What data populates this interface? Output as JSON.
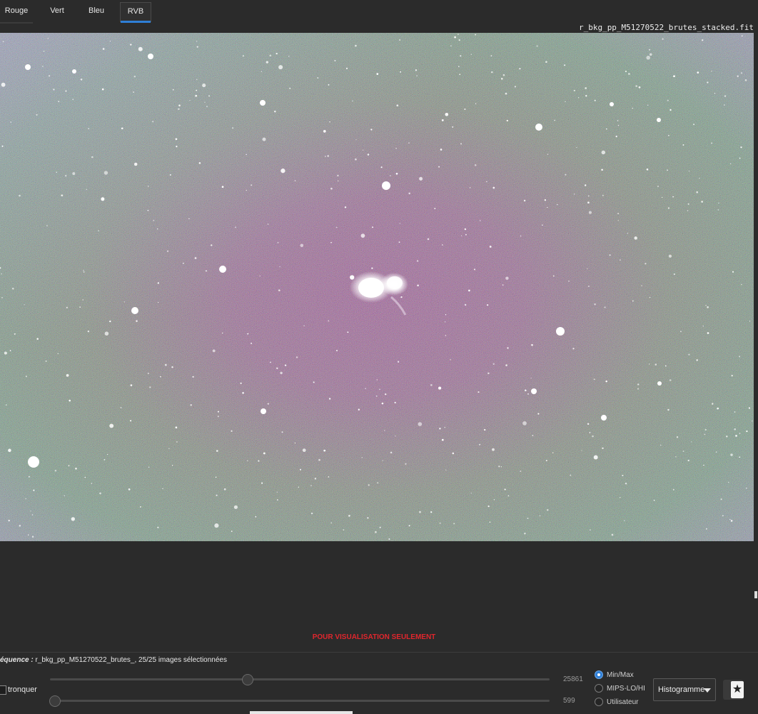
{
  "tabs": [
    {
      "label": "Rouge"
    },
    {
      "label": "Vert"
    },
    {
      "label": "Bleu"
    },
    {
      "label": "RVB"
    }
  ],
  "active_tab": "RVB",
  "filename": "r_bkg_pp_M51270522_brutes_stacked.fit",
  "watermark": "POUR VISUALISATION SEULEMENT",
  "sequence": {
    "label": "équence :",
    "text": "r_bkg_pp_M51270522_brutes_, 25/25 images sélectionnées"
  },
  "sliders": {
    "high_value": "25861",
    "low_value": "599"
  },
  "tronquer_label": "tronquer",
  "scale_modes": [
    {
      "label": "Min/Max",
      "selected": true
    },
    {
      "label": "MIPS-LO/HI",
      "selected": false
    },
    {
      "label": "Utilisateur",
      "selected": false
    }
  ],
  "display_mode": "Histogramme",
  "colors": {
    "accent": "#2f7fd6",
    "watermark": "#e0262d",
    "background": "#2b2b2b"
  },
  "icons": [
    "dropdown-arrow-icon",
    "image-tool-icon"
  ]
}
